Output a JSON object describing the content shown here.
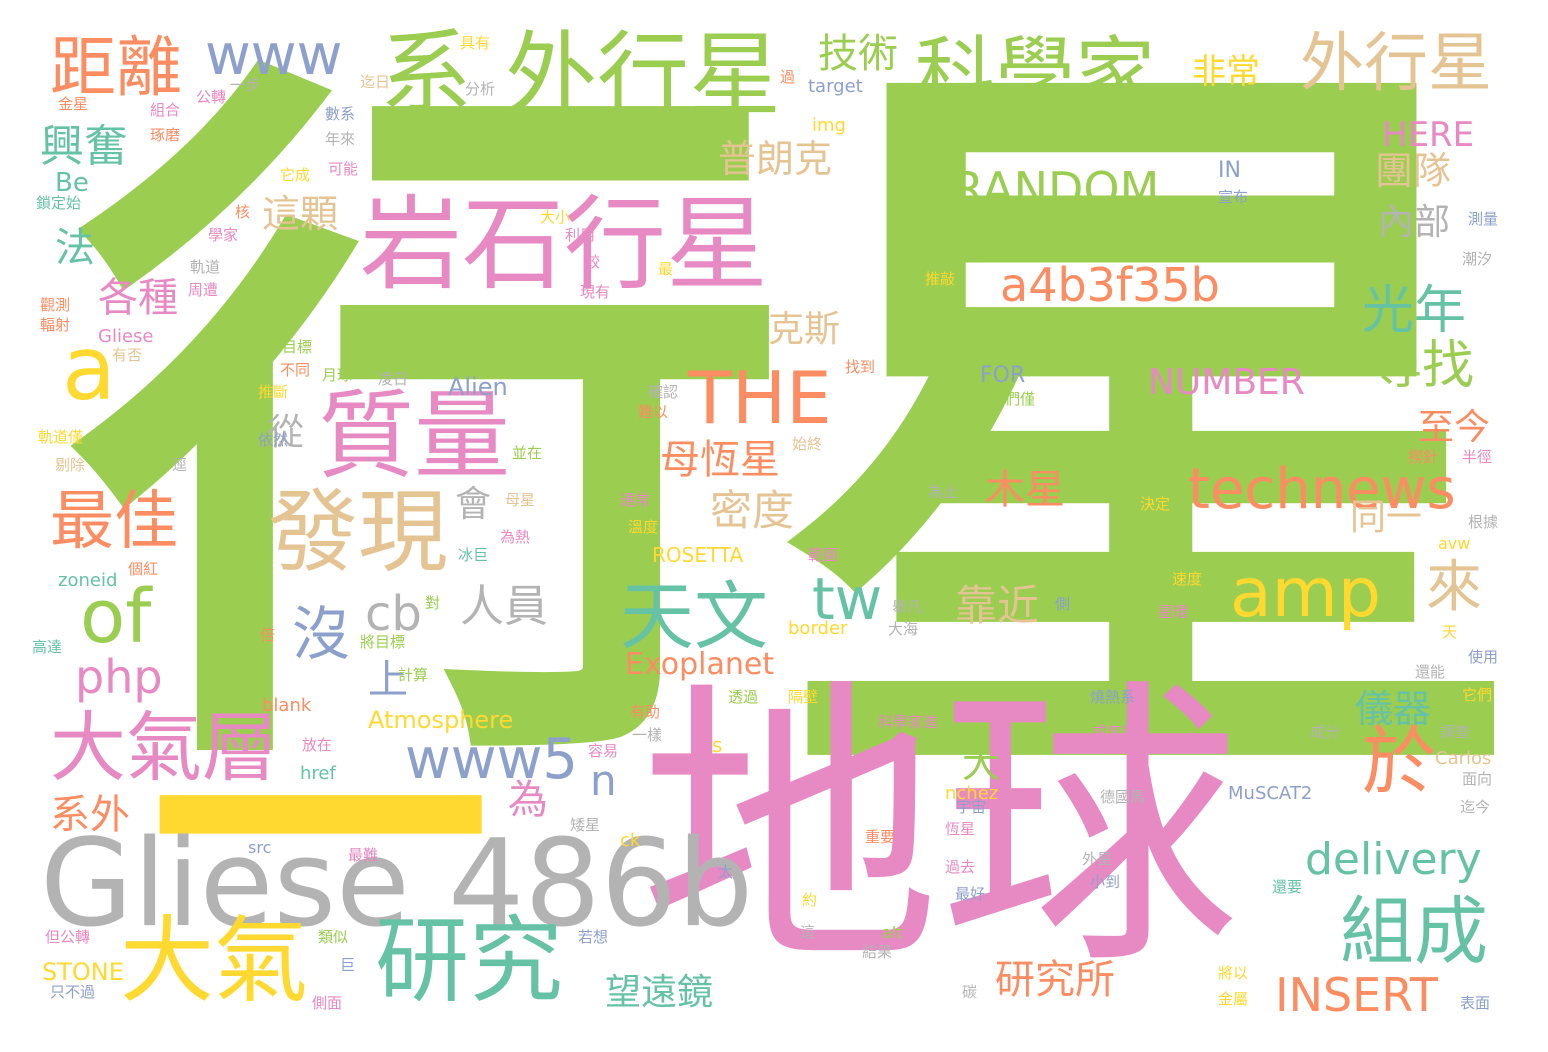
{
  "palette": {
    "green": "#9ACD50",
    "pink": "#E78AC3",
    "teal": "#66C2A5",
    "orange": "#FC8D62",
    "blue": "#8DA0CB",
    "yellow": "#FFD92F",
    "tan": "#E5C494",
    "gray": "#B3B3B3"
  },
  "words": [
    "行",
    "星",
    "地球",
    "一",
    "Gliese 486b",
    "岩石行星",
    "質量",
    "發現",
    "外行星",
    "系",
    "科學家",
    "外行星",
    "距離",
    "www",
    "a",
    "of",
    "大氣層",
    "大氣",
    "研究",
    "www5",
    "php",
    "沒",
    "cb",
    "人員",
    "天文",
    "tw",
    "amp",
    "technews",
    "於",
    "組成",
    "來",
    "delivery",
    "INSERT",
    "a4b3f35b",
    "THE",
    "RANDOM",
    "光年",
    "尋找",
    "技術",
    "非常",
    "HERE",
    "團隊",
    "內部",
    "NUMBER",
    "普朗克",
    "這顆",
    "克斯",
    "興奮",
    "各種",
    "法",
    "最佳",
    "母恆星",
    "密度",
    "木星",
    "從",
    "會",
    "至今",
    "同一",
    "靠近",
    "儀器",
    "大",
    "研究所",
    "望遠鏡",
    "系外",
    "為",
    "n",
    "上",
    "Exoplanet",
    "ROSETTA",
    "Atmosphere",
    "Alien",
    "FOR",
    "IN",
    "STONE",
    "Carlos",
    "MuSCAT2",
    "Gliese",
    "img",
    "target",
    "zoneid",
    "href",
    "src",
    "blank",
    "border",
    "alt",
    "ck",
    "s",
    "Be",
    "nchez",
    "avw",
    "具有",
    "迄日",
    "分析",
    "過",
    "金星",
    "一步",
    "組合",
    "公轉",
    "數系",
    "年來",
    "琢磨",
    "可能",
    "它成",
    "核",
    "大小",
    "利用",
    "學家",
    "較",
    "最",
    "軌道",
    "周遭",
    "現有",
    "宣布",
    "測量",
    "潮汐",
    "鎖定始",
    "推敲",
    "觀測",
    "輻射",
    "有否",
    "目標",
    "不同",
    "月球",
    "推斷",
    "凌日",
    "找到",
    "確認",
    "難以",
    "我們僅",
    "軌道僅",
    "剔除",
    "逕",
    "依然",
    "並在",
    "始終",
    "撈針",
    "半徑",
    "母星",
    "通常",
    "說",
    "為止",
    "決定",
    "根據",
    "為熱",
    "溫度",
    "冰巨",
    "範圍",
    "個紅",
    "對",
    "側",
    "速度",
    "舉凡",
    "星環",
    "高達",
    "倍",
    "將目標",
    "大海",
    "天",
    "使用",
    "還能",
    "它們",
    "計算",
    "透過",
    "隔壁",
    "有助",
    "燒熱系",
    "透",
    "成分",
    "調查",
    "放在",
    "一樣",
    "容易",
    "科學家進",
    "或氣態",
    "面向",
    "迄今",
    "宇宙",
    "恆星",
    "德國馬",
    "矮星",
    "最難",
    "重要",
    "過去",
    "外星",
    "小到",
    "太",
    "最好",
    "約",
    "還要",
    "但公轉",
    "類似",
    "這",
    "若想",
    "結果",
    "將以",
    "只不過",
    "巨",
    "側面",
    "金屬",
    "表面",
    "碳"
  ]
}
